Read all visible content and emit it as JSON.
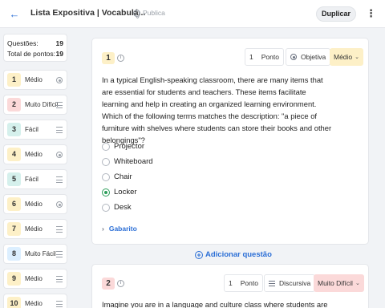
{
  "header": {
    "back_icon": "arrow-left-icon",
    "title": "Lista Expositiva | Vocabulá...",
    "visibility": "Publica",
    "duplicate_label": "Duplicar",
    "menu_icon": "kebab-icon"
  },
  "summary": {
    "questions_label": "Questões:",
    "questions_value": "19",
    "points_label": "Total de pontos:",
    "points_value": "19"
  },
  "sidebar": {
    "items": [
      {
        "num": "1",
        "label": "Médio",
        "icon": "radio-icon",
        "color": "#fdf0c7"
      },
      {
        "num": "2",
        "label": "Muito Difícil",
        "icon": "lines-icon",
        "color": "#fbd9d9"
      },
      {
        "num": "3",
        "label": "Fácil",
        "icon": "lines-icon",
        "color": "#d5f0ec"
      },
      {
        "num": "4",
        "label": "Médio",
        "icon": "radio-icon",
        "color": "#fdf0c7"
      },
      {
        "num": "5",
        "label": "Fácil",
        "icon": "lines-icon",
        "color": "#d5f0ec"
      },
      {
        "num": "6",
        "label": "Médio",
        "icon": "radio-icon",
        "color": "#fdf0c7"
      },
      {
        "num": "7",
        "label": "Médio",
        "icon": "lines-icon",
        "color": "#fdf0c7"
      },
      {
        "num": "8",
        "label": "Muito Fácil",
        "icon": "lines-icon",
        "color": "#dcefff"
      },
      {
        "num": "9",
        "label": "Médio",
        "icon": "lines-icon",
        "color": "#fdf0c7"
      },
      {
        "num": "10",
        "label": "Médio",
        "icon": "lines-icon",
        "color": "#fdf0c7"
      }
    ]
  },
  "q1": {
    "num": "1",
    "points_num": "1",
    "points_label": "Ponto",
    "type_label": "Objetiva",
    "difficulty": "Médio",
    "difficulty_color": "#fdf0c7",
    "text": "In a typical English-speaking classroom, there are many items that are essential for students and teachers. These items facilitate learning and help in creating an organized learning environment. Which of the following terms matches the description: \"a piece of furniture with shelves where students can store their books and other belongings\"?",
    "options": [
      "Projector",
      "Whiteboard",
      "Chair",
      "Locker",
      "Desk"
    ],
    "selected_index": 3,
    "answer_key_label": "Gabarito"
  },
  "add_question_label": "Adicionar questão",
  "q2": {
    "num": "2",
    "points_num": "1",
    "points_label": "Ponto",
    "type_label": "Discursiva",
    "difficulty": "Muito Difícil",
    "difficulty_color": "#fbd9d9",
    "text": "Imagine you are in a language and culture class where students are"
  }
}
